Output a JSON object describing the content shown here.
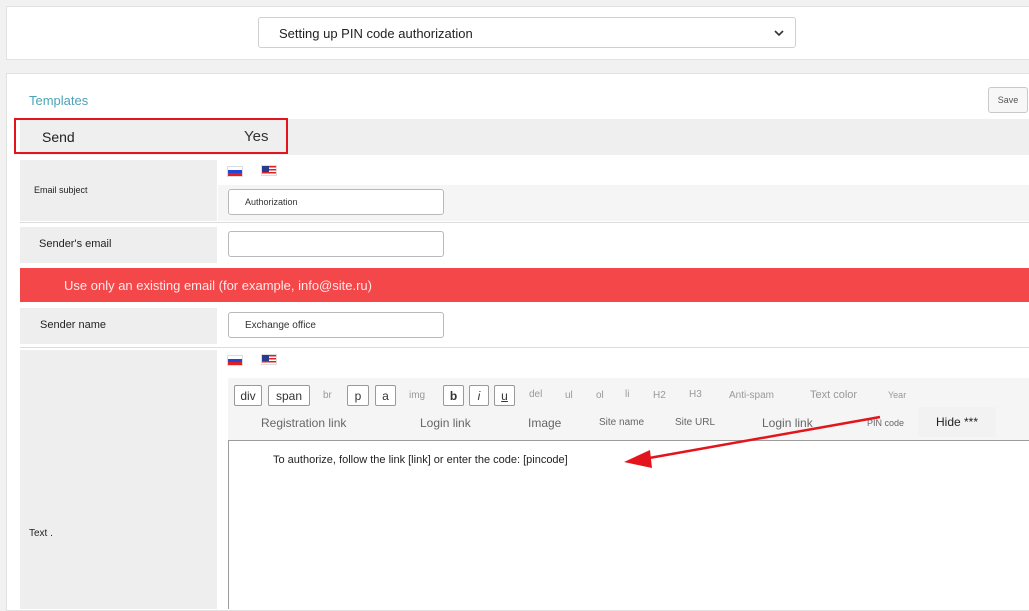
{
  "auth_select": {
    "value": "Setting up PIN code authorization"
  },
  "templates": {
    "title": "Templates",
    "save_label": "Save",
    "send": {
      "label": "Send",
      "value": "Yes"
    },
    "email_subject": {
      "label": "Email subject",
      "value": "Authorization"
    },
    "sender_email": {
      "label": "Sender's email",
      "value": ""
    },
    "warning": "Use only an existing email (for example, info@site.ru)",
    "sender_name": {
      "label": "Sender name",
      "value": "Exchange office"
    },
    "text": {
      "label": "Text .",
      "value": "To authorize, follow the link [link] or enter the code: [pincode]"
    },
    "languages": [
      "ru",
      "en"
    ]
  },
  "toolbar": {
    "tags": {
      "div": "div",
      "span": "span",
      "br": "br",
      "p": "p",
      "a": "a",
      "img": "img",
      "b": "b",
      "i": "i",
      "u": "u",
      "del": "del",
      "ul": "ul",
      "ol": "ol",
      "li": "li",
      "h2": "H2",
      "h3": "H3",
      "antispam": "Anti-spam",
      "textcolor": "Text color",
      "year": "Year"
    },
    "inserts": {
      "registration_link": "Registration link",
      "login_link_1": "Login link",
      "image": "Image",
      "site_name": "Site name",
      "site_url": "Site URL",
      "login_link_2": "Login link",
      "pin_code": "PIN code",
      "hide": "Hide ***"
    }
  },
  "colors": {
    "accent": "#4fa3b8",
    "warning": "#f4474a",
    "highlight": "#e3141c"
  }
}
